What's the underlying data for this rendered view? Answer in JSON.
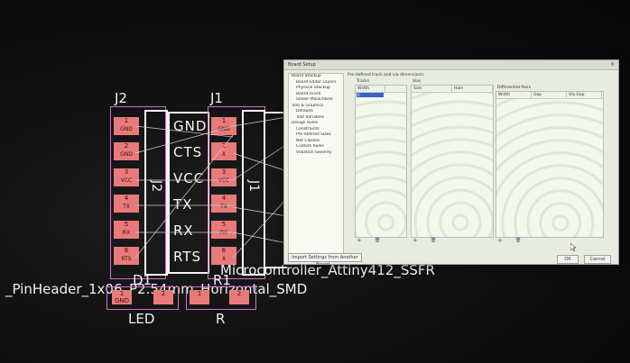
{
  "pcb": {
    "j2_ref": "J2",
    "j1_ref": "J1",
    "j2_value": "J2",
    "j1_value": "J1",
    "signals": [
      "GND",
      "CTS",
      "VCC",
      "TX",
      "RX",
      "RTS"
    ],
    "j2_pads": [
      {
        "num": "1",
        "label": "GND"
      },
      {
        "num": "2",
        "label": "GND"
      },
      {
        "num": "3",
        "label": "VCC"
      },
      {
        "num": "4",
        "label": "TX"
      },
      {
        "num": "5",
        "label": "RX"
      },
      {
        "num": "6",
        "label": "RTS"
      }
    ],
    "j1_pads": [
      {
        "num": "1",
        "label": "GND"
      },
      {
        "num": "2",
        "label": "X"
      },
      {
        "num": "3",
        "label": "VCC"
      },
      {
        "num": "4",
        "label": "TX"
      },
      {
        "num": "5",
        "label": "RX"
      },
      {
        "num": "6",
        "label": "X"
      }
    ],
    "mcu_text": "Microcontroller_Attiny412_SSFR",
    "overlap_text": "_PinHeader_1x06_P2.54mm_Horizontal_SMD",
    "d1_ref": "D1",
    "r1_ref": "R1",
    "led_value": "LED",
    "r_value": "R",
    "led_pads": [
      {
        "num": "1",
        "label": "GND"
      },
      {
        "num": "2",
        "label": ""
      }
    ],
    "r_pads": [
      {
        "num": "1",
        "label": ""
      },
      {
        "num": "2",
        "label": ""
      }
    ]
  },
  "dialog": {
    "title": "Board Setup",
    "close": "×",
    "tree": [
      "Board Stackup",
      "  Board Editor Layers",
      "  Physical Stackup",
      "  Board Finish",
      "  Solder Mask/Paste",
      "Text & Graphics",
      "  Defaults",
      "  Text Variables",
      "Design Rules",
      "  Constraints",
      "  Pre-defined Sizes",
      "  Net Classes",
      "  Custom Rules",
      "  Violation Severity"
    ],
    "section_title": "Pre-defined track and via dimensions:",
    "tracks_label": "Tracks",
    "tracks_header": [
      "Width"
    ],
    "tracks_row": "0",
    "vias_label": "Vias",
    "vias_header": [
      "Size",
      "Hole"
    ],
    "diff_label": "Differential Pairs",
    "diff_header": [
      "Width",
      "Gap",
      "Via Gap"
    ],
    "add_icon": "+",
    "delete_icon": "🗑",
    "import_button": "Import Settings from Another Board...",
    "ok_button": "OK",
    "cancel_button": "Cancel"
  }
}
